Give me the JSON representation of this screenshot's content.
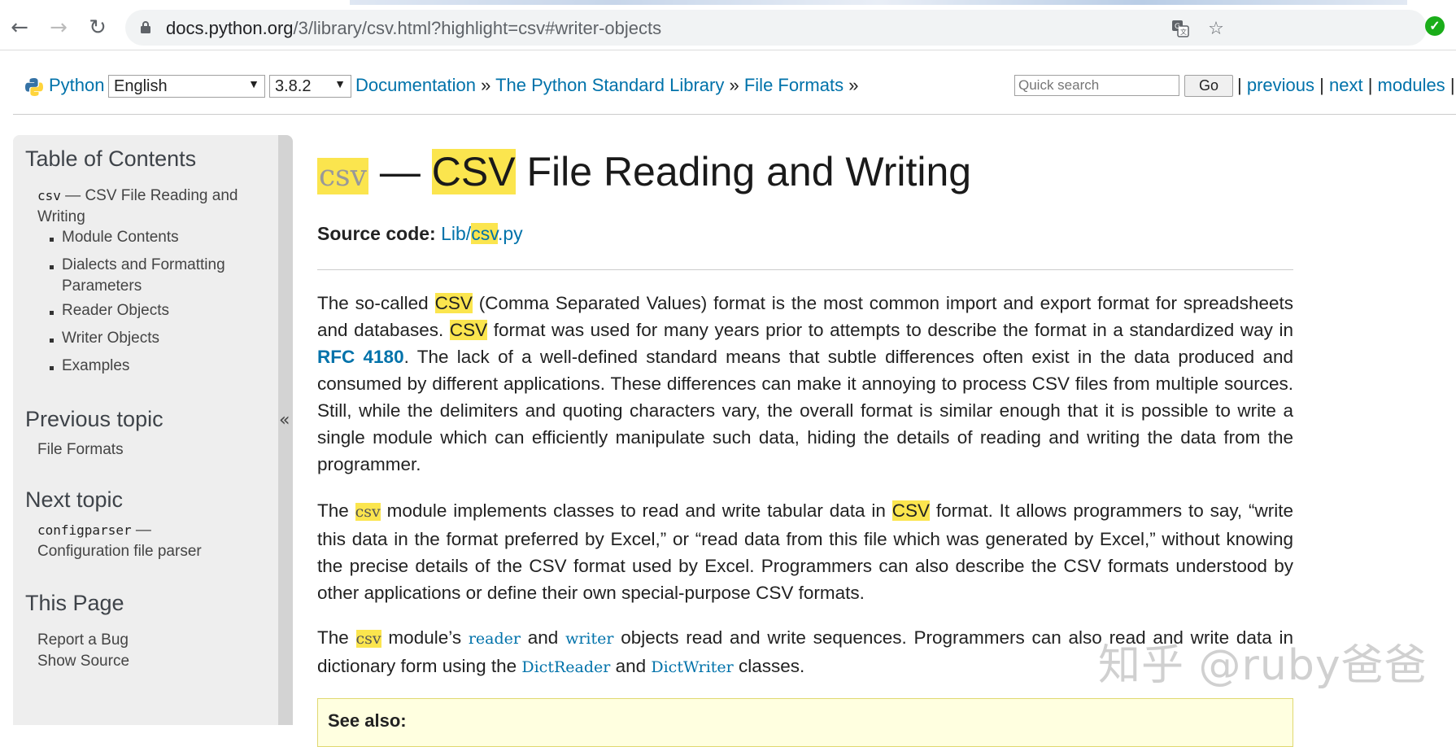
{
  "browser": {
    "url_host": "docs.python.org",
    "url_rest": "/3/library/csv.html?highlight=csv#writer-objects",
    "icons": [
      "back-icon",
      "forward-icon",
      "reload-icon",
      "lock-icon",
      "translate-icon",
      "star-icon",
      "extension-icon"
    ]
  },
  "related": {
    "python": "Python",
    "sep": "»",
    "language": "English",
    "version": "3.8.2",
    "crumbs": [
      "Documentation",
      "The Python Standard Library",
      "File Formats"
    ],
    "search_placeholder": "Quick search",
    "go": "Go",
    "nav": [
      "previous",
      "next",
      "modules"
    ],
    "pipe": "|"
  },
  "sidebar": {
    "toc_title": "Table of Contents",
    "toc_mod": "csv",
    "toc_main_line1": " — CSV File Reading and",
    "toc_main_line2": "Writing",
    "toc_items": [
      "Module Contents",
      "Dialects and Formatting",
      "Parameters",
      "Reader Objects",
      "Writer Objects",
      "Examples"
    ],
    "prev_title": "Previous topic",
    "prev_link": "File Formats",
    "next_title": "Next topic",
    "next_mod": "configparser",
    "next_dash": " —",
    "next_desc": "Configuration file parser",
    "page_title": "This Page",
    "page_links": [
      "Report a Bug",
      "Show Source"
    ],
    "collapse": "«"
  },
  "main": {
    "title_mod": "csv",
    "title_dash": " — ",
    "title_hl": "CSV",
    "title_rest": " File Reading and Writing",
    "source_label": "Source code:",
    "source_link_a": "Lib/",
    "source_link_b": "csv",
    "source_link_c": ".py",
    "p1": {
      "a": "The so-called ",
      "hl1": "CSV",
      "b": " (Comma Separated Values) format is the most common import and export format for spreadsheets and databases. ",
      "hl2": "CSV",
      "c": " format was used for many years prior to attempts to describe the format in a standardized way in ",
      "rfc": "RFC 4180",
      "d": ". The lack of a well-defined standard means that subtle differences often exist in the data produced and consumed by different applications. These differences can make it annoying to process CSV files from multiple sources. Still, while the delimiters and quoting characters vary, the overall format is similar enough that it is possible to write a single module which can efficiently manipulate such data, hiding the details of reading and writing the data from the programmer."
    },
    "p2": {
      "a": "The ",
      "mod": "csv",
      "b": " module implements classes to read and write tabular data in ",
      "hl": "CSV",
      "c": " format. It allows programmers to say, “write this data in the format preferred by Excel,” or “read data from this file which was generated by Excel,” without knowing the precise details of the CSV format used by Excel. Programmers can also describe the CSV formats understood by other applications or define their own special-purpose CSV formats."
    },
    "p3": {
      "a": "The ",
      "mod": "csv",
      "b": " module’s ",
      "reader": "reader",
      "c": " and ",
      "writer": "writer",
      "d": " objects read and write sequences. Programmers can also read and write data in dictionary form using the ",
      "dictreader": "DictReader",
      "e": " and ",
      "dictwriter": "DictWriter",
      "f": " classes."
    },
    "see_also": "See also:"
  },
  "watermark": "知乎 @ruby爸爸"
}
